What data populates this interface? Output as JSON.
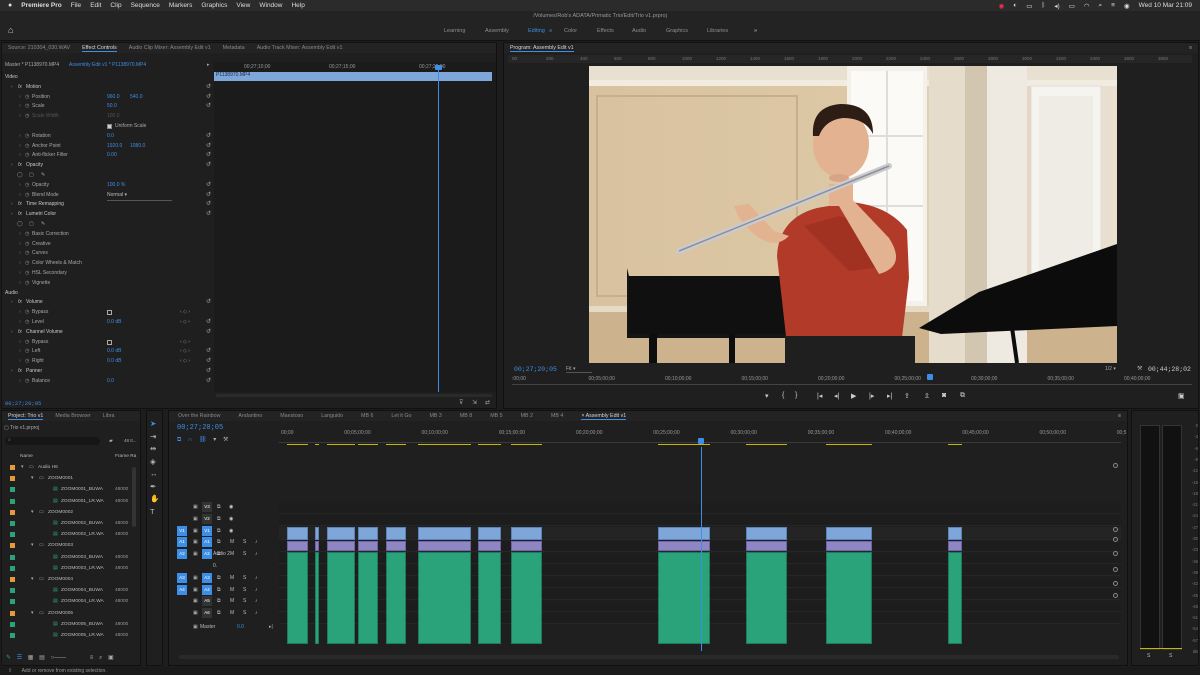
{
  "menubar": {
    "apple": "",
    "app": "Premiere Pro",
    "items": [
      "File",
      "Edit",
      "Clip",
      "Sequence",
      "Markers",
      "Graphics",
      "View",
      "Window",
      "Help"
    ],
    "clock": "Wed 10 Mar  21:09"
  },
  "window_title": "/Volumes/Rob's ADATA/Primatic Trio/Edit/Trio v1.prproj",
  "workspaces": {
    "items": [
      "Learning",
      "Assembly",
      "Editing",
      "Color",
      "Effects",
      "Audio",
      "Graphics",
      "Libraries"
    ],
    "active": "Editing",
    "more": "»"
  },
  "source_panel": {
    "tabs": [
      "Source: 210304_030.WAV",
      "Effect Controls",
      "Audio Clip Mixer: Assembly Edit v1",
      "Metadata",
      "Audio Track Mixer: Assembly Edit v1"
    ],
    "active_tab": "Effect Controls",
    "master_label": "Master * P1138970.MP4",
    "seq_label": "Assembly Edit v1 * P1138970.MP4",
    "ruler": [
      "00;27;10;00",
      "00;27;15;00",
      "00;27;20;00"
    ],
    "clip_name": "P1138970.MP4",
    "timecode": "00;27;20;05",
    "rows": [
      {
        "indent": 0,
        "label": "Video",
        "kind": "section"
      },
      {
        "indent": 1,
        "label": "Motion",
        "kind": "fx"
      },
      {
        "indent": 2,
        "label": "Position",
        "v1": "960.0",
        "v2": "540.0"
      },
      {
        "indent": 2,
        "label": "Scale",
        "v1": "50.0"
      },
      {
        "indent": 2,
        "label": "Scale Width",
        "v1": "100.0",
        "dim": true
      },
      {
        "indent": 3,
        "label": "",
        "check": "Uniform Scale"
      },
      {
        "indent": 2,
        "label": "Rotation",
        "v1": "0.0"
      },
      {
        "indent": 2,
        "label": "Anchor Point",
        "v1": "1920.0",
        "v2": "1080.0"
      },
      {
        "indent": 2,
        "label": "Anti-flicker Filter",
        "v1": "0.00"
      },
      {
        "indent": 1,
        "label": "Opacity",
        "kind": "fx"
      },
      {
        "indent": 2,
        "label": "",
        "shapes": true
      },
      {
        "indent": 2,
        "label": "Opacity",
        "v1": "100.0 %"
      },
      {
        "indent": 2,
        "label": "Blend Mode",
        "select": "Normal"
      },
      {
        "indent": 1,
        "label": "Time Remapping",
        "kind": "fx"
      },
      {
        "indent": 1,
        "label": "Lumetri Color",
        "kind": "fx"
      },
      {
        "indent": 2,
        "label": "",
        "shapes": true
      },
      {
        "indent": 2,
        "label": "Basic Correction"
      },
      {
        "indent": 2,
        "label": "Creative"
      },
      {
        "indent": 2,
        "label": "Curves"
      },
      {
        "indent": 2,
        "label": "Color Wheels & Match"
      },
      {
        "indent": 2,
        "label": "HSL Secondary"
      },
      {
        "indent": 2,
        "label": "Vignette"
      },
      {
        "indent": 0,
        "label": "Audio",
        "kind": "section"
      },
      {
        "indent": 1,
        "label": "Volume",
        "kind": "fx"
      },
      {
        "indent": 2,
        "label": "Bypass",
        "box": true
      },
      {
        "indent": 2,
        "label": "Level",
        "v1": "0.0 dB"
      },
      {
        "indent": 1,
        "label": "Channel Volume",
        "kind": "fx"
      },
      {
        "indent": 2,
        "label": "Bypass",
        "box": true
      },
      {
        "indent": 2,
        "label": "Left",
        "v1": "0.0 dB"
      },
      {
        "indent": 2,
        "label": "Right",
        "v1": "0.0 dB"
      },
      {
        "indent": 1,
        "label": "Panner",
        "kind": "fx"
      },
      {
        "indent": 2,
        "label": "Balance",
        "v1": "0.0"
      }
    ]
  },
  "program": {
    "title": "Program: Assembly Edit v1",
    "ruler": [
      "00",
      "200",
      "400",
      "600",
      "800",
      "1000",
      "1200",
      "1400",
      "1600",
      "1800",
      "2000",
      "2200",
      "2400",
      "2600",
      "2800",
      "3000",
      "3200",
      "3400",
      "3600",
      "3800"
    ],
    "timecode": "00;27;20;05",
    "fit": "Fit",
    "scale": "1/2",
    "duration": "00;44;28;02",
    "timeline": [
      ":00;00",
      "00;05;00;00",
      "00;10;00;00",
      "00;15;00;00",
      "00;20;00;00",
      "00;25;00;00",
      "00;30;00;00",
      "00;35;00;00",
      "00;40;00;00"
    ],
    "playhead_fraction": 0.615,
    "controls": [
      "marker-icon",
      "mark-in-icon",
      "mark-out-icon",
      "go-to-in-icon",
      "step-back-icon",
      "play-icon",
      "step-forward-icon",
      "go-to-out-icon",
      "lift-icon",
      "extract-icon",
      "export-frame-icon",
      "compare-icon",
      "overlay-icon",
      "add-icon"
    ]
  },
  "project": {
    "tabs": [
      "Project: Trio v1",
      "Media Browser",
      "Libra"
    ],
    "file": "Trio v1.prproj",
    "count": "48 It...",
    "columns": [
      "Name",
      "Frame Ra"
    ],
    "items": [
      {
        "depth": 0,
        "type": "folder",
        "name": "Audio H6",
        "color": "#e59a3a"
      },
      {
        "depth": 1,
        "type": "folder",
        "name": "ZOOM0001",
        "color": "#e59a3a"
      },
      {
        "depth": 2,
        "type": "audio",
        "name": "ZOOM0001_BUWA",
        "rate": "48000",
        "color": "#2ba37a"
      },
      {
        "depth": 2,
        "type": "audio",
        "name": "ZOOM0001_LR.WA",
        "rate": "48000",
        "color": "#2ba37a"
      },
      {
        "depth": 1,
        "type": "folder",
        "name": "ZOOM0002",
        "color": "#e59a3a"
      },
      {
        "depth": 2,
        "type": "audio",
        "name": "ZOOM0002_BUWA",
        "rate": "48000",
        "color": "#2ba37a"
      },
      {
        "depth": 2,
        "type": "audio",
        "name": "ZOOM0002_LR.WA",
        "rate": "48000",
        "color": "#2ba37a"
      },
      {
        "depth": 1,
        "type": "folder",
        "name": "ZOOM0003",
        "color": "#e59a3a"
      },
      {
        "depth": 2,
        "type": "audio",
        "name": "ZOOM0003_BUWA",
        "rate": "48000",
        "color": "#2ba37a"
      },
      {
        "depth": 2,
        "type": "audio",
        "name": "ZOOM0003_LR.WA",
        "rate": "48000",
        "color": "#2ba37a"
      },
      {
        "depth": 1,
        "type": "folder",
        "name": "ZOOM0004",
        "color": "#e59a3a"
      },
      {
        "depth": 2,
        "type": "audio",
        "name": "ZOOM0004_BUWA",
        "rate": "48000",
        "color": "#2ba37a"
      },
      {
        "depth": 2,
        "type": "audio",
        "name": "ZOOM0004_LR.WA",
        "rate": "48000",
        "color": "#2ba37a"
      },
      {
        "depth": 1,
        "type": "folder",
        "name": "ZOOM0005",
        "color": "#e59a3a"
      },
      {
        "depth": 2,
        "type": "audio",
        "name": "ZOOM0005_BUWA",
        "rate": "48000",
        "color": "#2ba37a"
      },
      {
        "depth": 2,
        "type": "audio",
        "name": "ZOOM0005_LR.WA",
        "rate": "48000",
        "color": "#2ba37a"
      }
    ]
  },
  "timeline": {
    "tabs": [
      "Over the Rainbow",
      "Andantino",
      "Maestoso",
      "Languido",
      "MB 6",
      "Let it Go",
      "MB 3",
      "MB 8",
      "MB 5",
      "MB 2",
      "MB 4",
      "Assembly Edit v1"
    ],
    "active_tab": "Assembly Edit v1",
    "timecode": "00;27;20;05",
    "ruler": [
      "00;00",
      "00;05;00;00",
      "00;10;00;00",
      "00;15;00;00",
      "00;20;00;00",
      "00;25;00;00",
      "00;30;00;00",
      "00;35;00;00",
      "00;40;00;00",
      "00;45;00;00",
      "00;50;00;00",
      "00;5"
    ],
    "tracks": [
      {
        "id": "V3",
        "src": "",
        "label": ""
      },
      {
        "id": "V2",
        "src": "",
        "label": ""
      },
      {
        "id": "V1",
        "src": "V1",
        "label": ""
      },
      {
        "id": "A1",
        "src": "A1",
        "label": ""
      },
      {
        "id": "A2",
        "src": "A2",
        "label": "Audio 2"
      },
      {
        "id": "",
        "src": "",
        "label": "0."
      },
      {
        "id": "A3",
        "src": "A3",
        "label": ""
      },
      {
        "id": "A4",
        "src": "A4",
        "label": ""
      },
      {
        "id": "A5",
        "src": "",
        "label": ""
      },
      {
        "id": "A6",
        "src": "",
        "label": ""
      }
    ],
    "master_label": "Master",
    "master_value": "0.0",
    "clip_groups_minutes": [
      [
        0.5,
        1.9
      ],
      [
        2.3,
        2.6
      ],
      [
        3.1,
        4.9
      ],
      [
        5.1,
        6.4
      ],
      [
        6.9,
        8.2
      ],
      [
        9.0,
        12.4
      ],
      [
        12.9,
        14.4
      ],
      [
        15.0,
        17.0
      ],
      [
        24.5,
        27.9
      ],
      [
        30.2,
        32.9
      ],
      [
        35.4,
        38.4
      ],
      [
        43.3,
        44.2
      ]
    ],
    "playhead_minutes": 27.34,
    "total_minutes": 54.5
  },
  "audio_meter": {
    "ticks": [
      "0",
      "-3",
      "-6",
      "-9",
      "-12",
      "-15",
      "-18",
      "-21",
      "-24",
      "-27",
      "-30",
      "-33",
      "-36",
      "-39",
      "-42",
      "-45",
      "-48",
      "-51",
      "-54",
      "-57",
      "dB"
    ],
    "solo": [
      "S",
      "S"
    ]
  },
  "tools": [
    "selection-tool-icon",
    "track-select-icon",
    "ripple-edit-icon",
    "razor-icon",
    "slip-icon",
    "pen-icon",
    "hand-icon",
    "type-icon"
  ],
  "status": "Add or remove from existing selection.",
  "colors": {
    "accent": "#3d8ee6",
    "video_clip": "#7fa6d8",
    "audio_clip": "#2ba37a",
    "folder": "#e59a3a"
  }
}
